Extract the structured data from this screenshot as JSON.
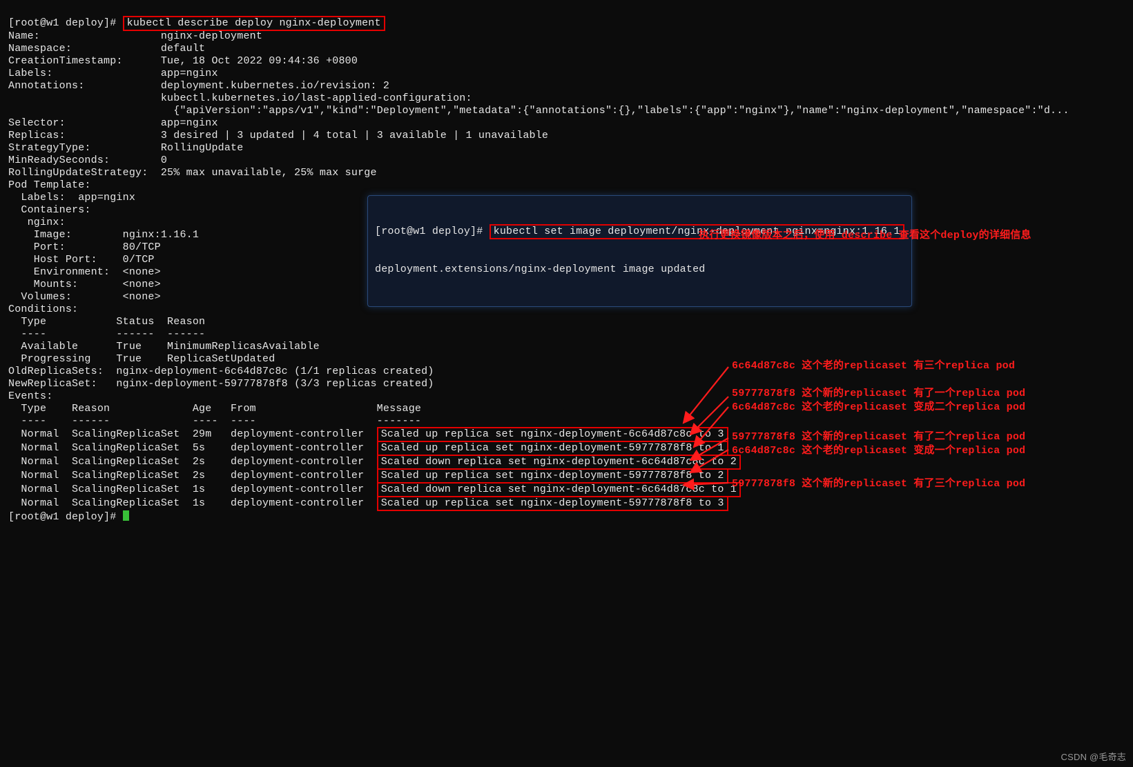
{
  "prompt1_prefix": "[root@w1 deploy]# ",
  "prompt1_cmd": "kubectl describe deploy nginx-deployment",
  "describe": {
    "labels": [
      "Name:",
      "Namespace:",
      "CreationTimestamp:",
      "Labels:",
      "Annotations:",
      "",
      "",
      "Selector:",
      "Replicas:",
      "StrategyType:",
      "MinReadySeconds:",
      "RollingUpdateStrategy:"
    ],
    "values": {
      "Name": "nginx-deployment",
      "Namespace": "default",
      "CreationTimestamp": "Tue, 18 Oct 2022 09:44:36 +0800",
      "Labels": "app=nginx",
      "Annotations_l1": "deployment.kubernetes.io/revision: 2",
      "Annotations_l2": "kubectl.kubernetes.io/last-applied-configuration:",
      "Annotations_l3": "  {\"apiVersion\":\"apps/v1\",\"kind\":\"Deployment\",\"metadata\":{\"annotations\":{},\"labels\":{\"app\":\"nginx\"},\"name\":\"nginx-deployment\",\"namespace\":\"d...",
      "Selector": "app=nginx",
      "Replicas": "3 desired | 3 updated | 4 total | 3 available | 1 unavailable",
      "StrategyType": "RollingUpdate",
      "MinReadySeconds": "0",
      "RollingUpdateStrategy": "25% max unavailable, 25% max surge"
    },
    "PodTemplate": {
      "header": "Pod Template:",
      "LabelsLine": "  Labels:  app=nginx",
      "Containers": "  Containers:",
      "containerName": "   nginx:",
      "Image": "    Image:        nginx:1.16.1",
      "Port": "    Port:         80/TCP",
      "HostPort": "    Host Port:    0/TCP",
      "Environment": "    Environment:  <none>",
      "Mounts": "    Mounts:       <none>",
      "Volumes": "  Volumes:        <none>"
    },
    "Conditions": {
      "header": "Conditions:",
      "cols": "  Type           Status  Reason",
      "divs": "  ----           ------  ------",
      "row1": "  Available      True    MinimumReplicasAvailable",
      "row2": "  Progressing    True    ReplicaSetUpdated"
    },
    "OldReplicaSets": "OldReplicaSets:  nginx-deployment-6c64d87c8c (1/1 replicas created)",
    "NewReplicaSet": "NewReplicaSet:   nginx-deployment-59777878f8 (3/3 replicas created)",
    "Events": {
      "header": "Events:",
      "cols": "  Type    Reason             Age   From                   Message",
      "divs": "  ----    ------             ----  ----                   -------",
      "rows": [
        {
          "prefix": "  Normal  ScalingReplicaSet  29m   deployment-controller  ",
          "msg": "Scaled up replica set nginx-deployment-6c64d87c8c to 3"
        },
        {
          "prefix": "  Normal  ScalingReplicaSet  5s    deployment-controller  ",
          "msg": "Scaled up replica set nginx-deployment-59777878f8 to 1"
        },
        {
          "prefix": "  Normal  ScalingReplicaSet  2s    deployment-controller  ",
          "msg": "Scaled down replica set nginx-deployment-6c64d87c8c to 2"
        },
        {
          "prefix": "  Normal  ScalingReplicaSet  2s    deployment-controller  ",
          "msg": "Scaled up replica set nginx-deployment-59777878f8 to 2"
        },
        {
          "prefix": "  Normal  ScalingReplicaSet  1s    deployment-controller  ",
          "msg": "Scaled down replica set nginx-deployment-6c64d87c8c to 1"
        },
        {
          "prefix": "  Normal  ScalingReplicaSet  1s    deployment-controller  ",
          "msg": "Scaled up replica set nginx-deployment-59777878f8 to 3"
        }
      ]
    }
  },
  "prompt2_prefix": "[root@w1 deploy]# ",
  "callout": {
    "prompt": "[root@w1 deploy]# ",
    "cmd": "kubectl set image deployment/nginx-deployment nginx=nginx:1.16.1",
    "response": "deployment.extensions/nginx-deployment image updated"
  },
  "annotations": {
    "under_callout": "执行更换镜像版本之后，使用 describe 查看这个deploy的详细信息",
    "a1": "6c64d87c8c 这个老的replicaset 有三个replica pod",
    "a2": "59777878f8 这个新的replicaset 有了一个replica pod",
    "a3": "6c64d87c8c 这个老的replicaset 变成二个replica pod",
    "a4": "59777878f8 这个新的replicaset 有了二个replica pod",
    "a5": "6c64d87c8c 这个老的replicaset 变成一个replica pod",
    "a6": "59777878f8 这个新的replicaset 有了三个replica pod"
  },
  "watermark": "CSDN @毛奇志"
}
